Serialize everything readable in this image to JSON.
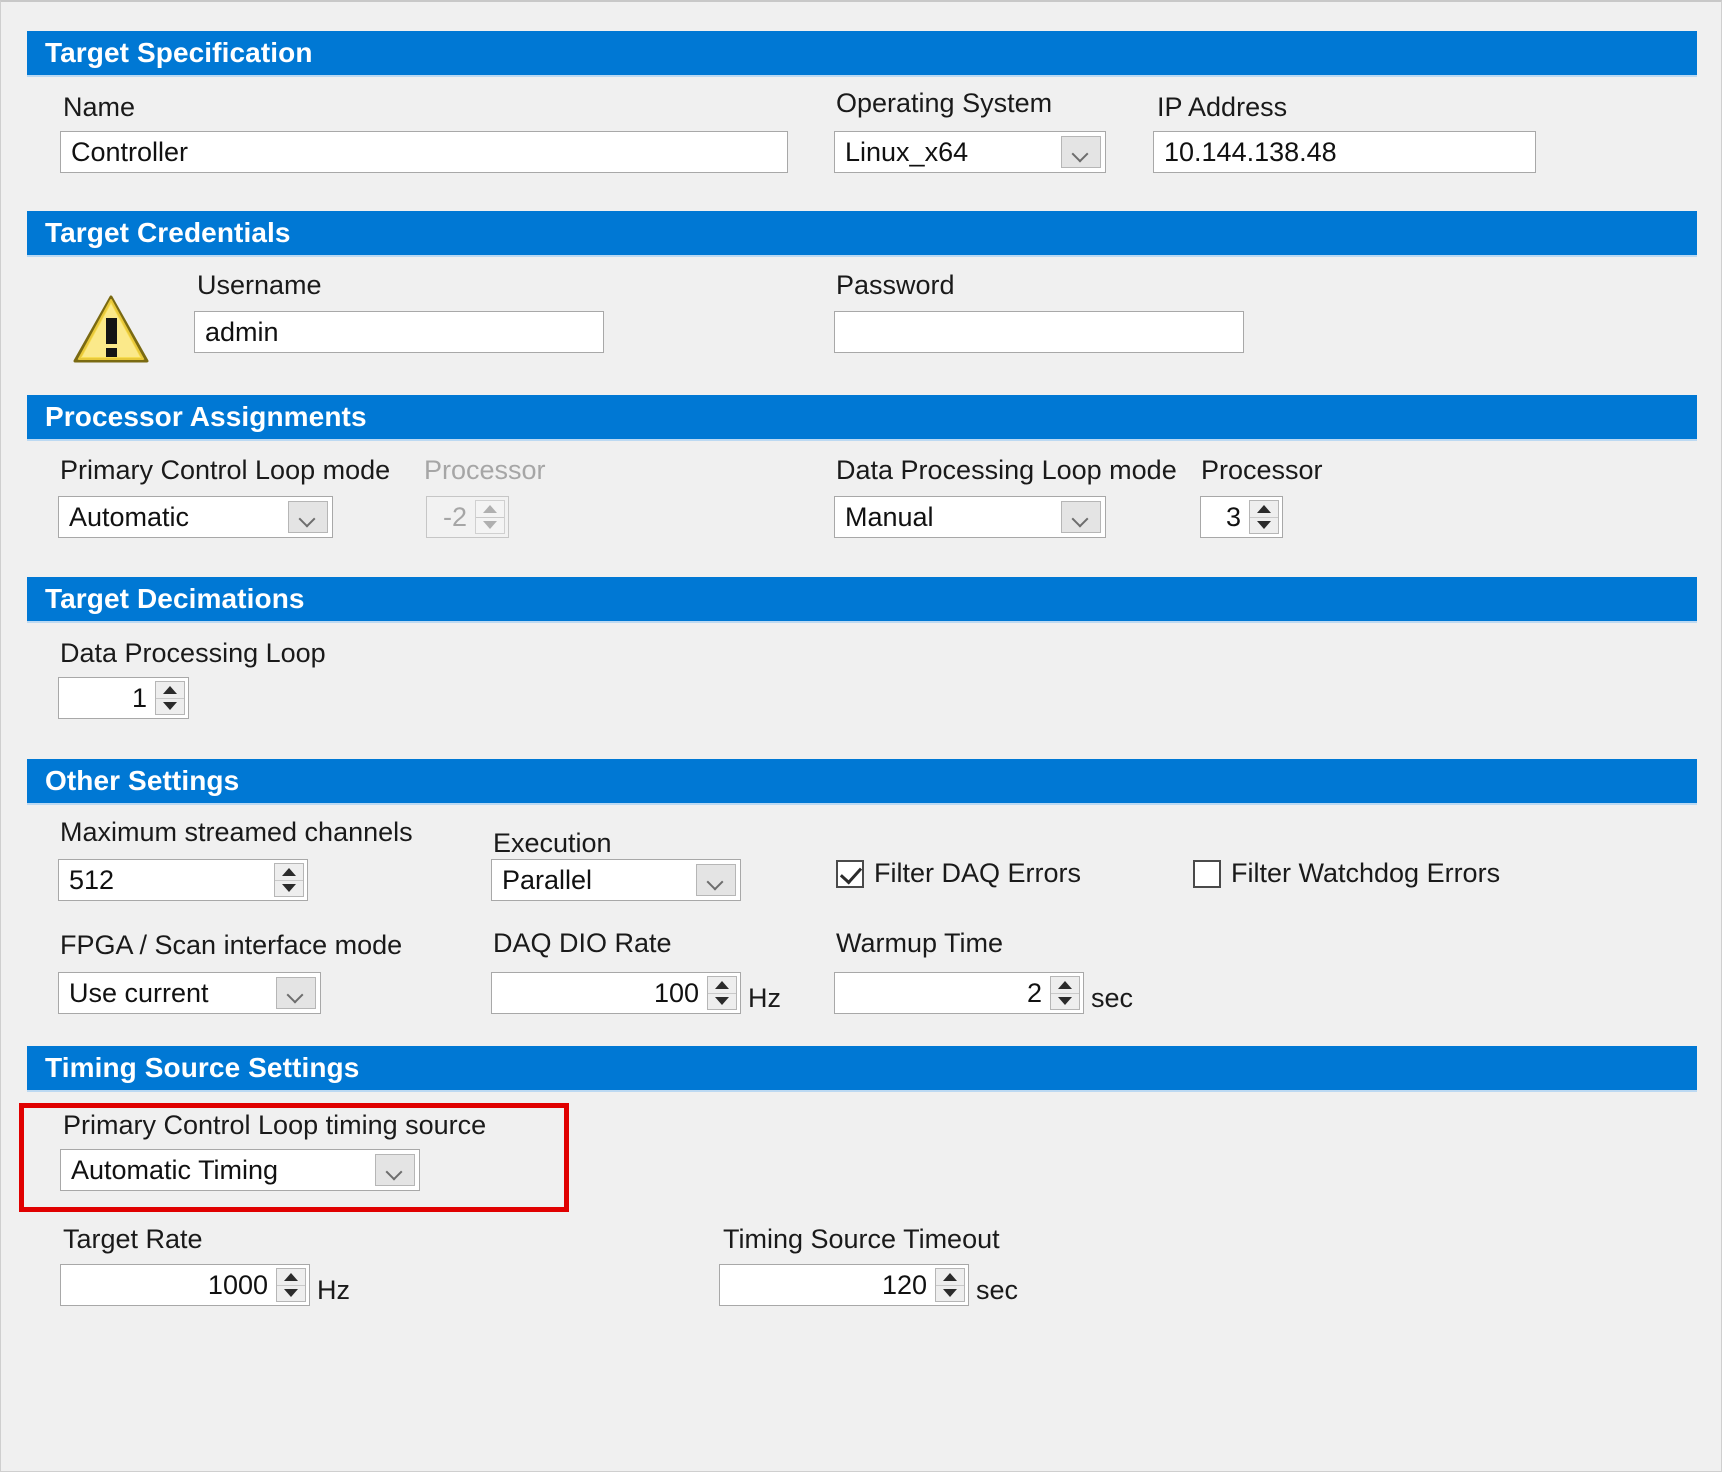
{
  "sections": {
    "target_specification": {
      "title": "Target Specification",
      "name_label": "Name",
      "name_value": "Controller",
      "os_label": "Operating System",
      "os_value": "Linux_x64",
      "ip_label": "IP Address",
      "ip_value": "10.144.138.48"
    },
    "target_credentials": {
      "title": "Target Credentials",
      "warning_icon": "warning-triangle-icon",
      "username_label": "Username",
      "username_value": "admin",
      "password_label": "Password",
      "password_value": ""
    },
    "processor_assignments": {
      "title": "Processor Assignments",
      "primary_mode_label": "Primary Control Loop mode",
      "primary_mode_value": "Automatic",
      "primary_processor_label": "Processor",
      "primary_processor_value": "-2",
      "primary_processor_disabled": true,
      "data_mode_label": "Data Processing Loop mode",
      "data_mode_value": "Manual",
      "data_processor_label": "Processor",
      "data_processor_value": "3"
    },
    "target_decimations": {
      "title": "Target Decimations",
      "dpl_label": "Data Processing Loop",
      "dpl_value": "1"
    },
    "other_settings": {
      "title": "Other Settings",
      "max_channels_label": "Maximum streamed channels",
      "max_channels_value": "512",
      "execution_label": "Execution",
      "execution_value": "Parallel",
      "filter_daq_label": "Filter DAQ Errors",
      "filter_daq_checked": true,
      "filter_watchdog_label": "Filter Watchdog Errors",
      "filter_watchdog_checked": false,
      "fpga_label": "FPGA / Scan interface mode",
      "fpga_value": "Use current",
      "daq_dio_label": "DAQ DIO Rate",
      "daq_dio_value": "100",
      "daq_dio_unit": "Hz",
      "warmup_label": "Warmup Time",
      "warmup_value": "2",
      "warmup_unit": "sec"
    },
    "timing_source_settings": {
      "title": "Timing Source Settings",
      "pcl_timing_label": "Primary Control Loop timing source",
      "pcl_timing_value": "Automatic Timing",
      "target_rate_label": "Target Rate",
      "target_rate_value": "1000",
      "target_rate_unit": "Hz",
      "timeout_label": "Timing Source Timeout",
      "timeout_value": "120",
      "timeout_unit": "sec"
    }
  },
  "colors": {
    "section_header": "#0078d4",
    "highlight": "#e00000",
    "background": "#f0f0f0",
    "warning": "#f5d130"
  }
}
